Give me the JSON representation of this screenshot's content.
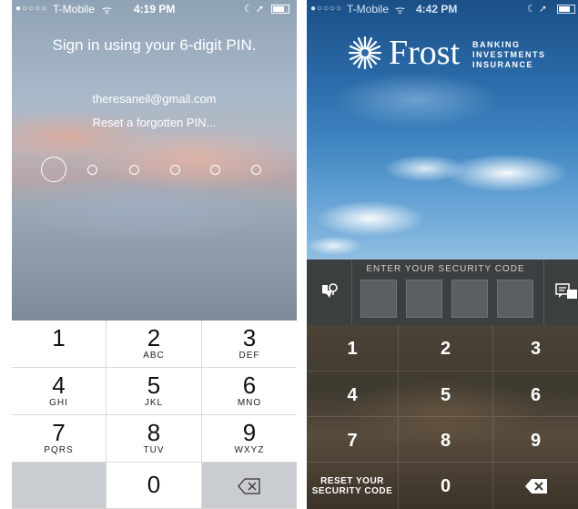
{
  "left": {
    "statusbar": {
      "signal": "●○○○○",
      "carrier": "T-Mobile",
      "time": "4:19 PM",
      "icons": "☾ ➚"
    },
    "title": "Sign in using your 6-digit PIN.",
    "email": "theresaneil@gmail.com",
    "reset_link": "Reset a forgotten PIN...",
    "pin_length": 6,
    "keys": [
      {
        "num": "1",
        "sub": ""
      },
      {
        "num": "2",
        "sub": "ABC"
      },
      {
        "num": "3",
        "sub": "DEF"
      },
      {
        "num": "4",
        "sub": "GHI"
      },
      {
        "num": "5",
        "sub": "JKL"
      },
      {
        "num": "6",
        "sub": "MNO"
      },
      {
        "num": "7",
        "sub": "PQRS"
      },
      {
        "num": "8",
        "sub": "TUV"
      },
      {
        "num": "9",
        "sub": "WXYZ"
      },
      {
        "num": "0",
        "sub": ""
      }
    ]
  },
  "right": {
    "statusbar": {
      "signal": "●○○○○",
      "carrier": "T-Mobile",
      "time": "4:42 PM",
      "icons": "☾ ➚"
    },
    "brand": {
      "name": "Frost",
      "tagline": [
        "BANKING",
        "INVESTMENTS",
        "INSURANCE"
      ]
    },
    "code_label": "ENTER YOUR SECURITY CODE",
    "keys": [
      "1",
      "2",
      "3",
      "4",
      "5",
      "6",
      "7",
      "8",
      "9",
      "0"
    ],
    "reset_label": [
      "RESET YOUR",
      "SECURITY CODE"
    ]
  },
  "colors": {
    "left_keypad_bg": "#ffffff",
    "left_special_key_bg": "#c9cdd2",
    "right_codebar_bg": "#3c3f40",
    "frost_sky": "#2a6aa8"
  }
}
